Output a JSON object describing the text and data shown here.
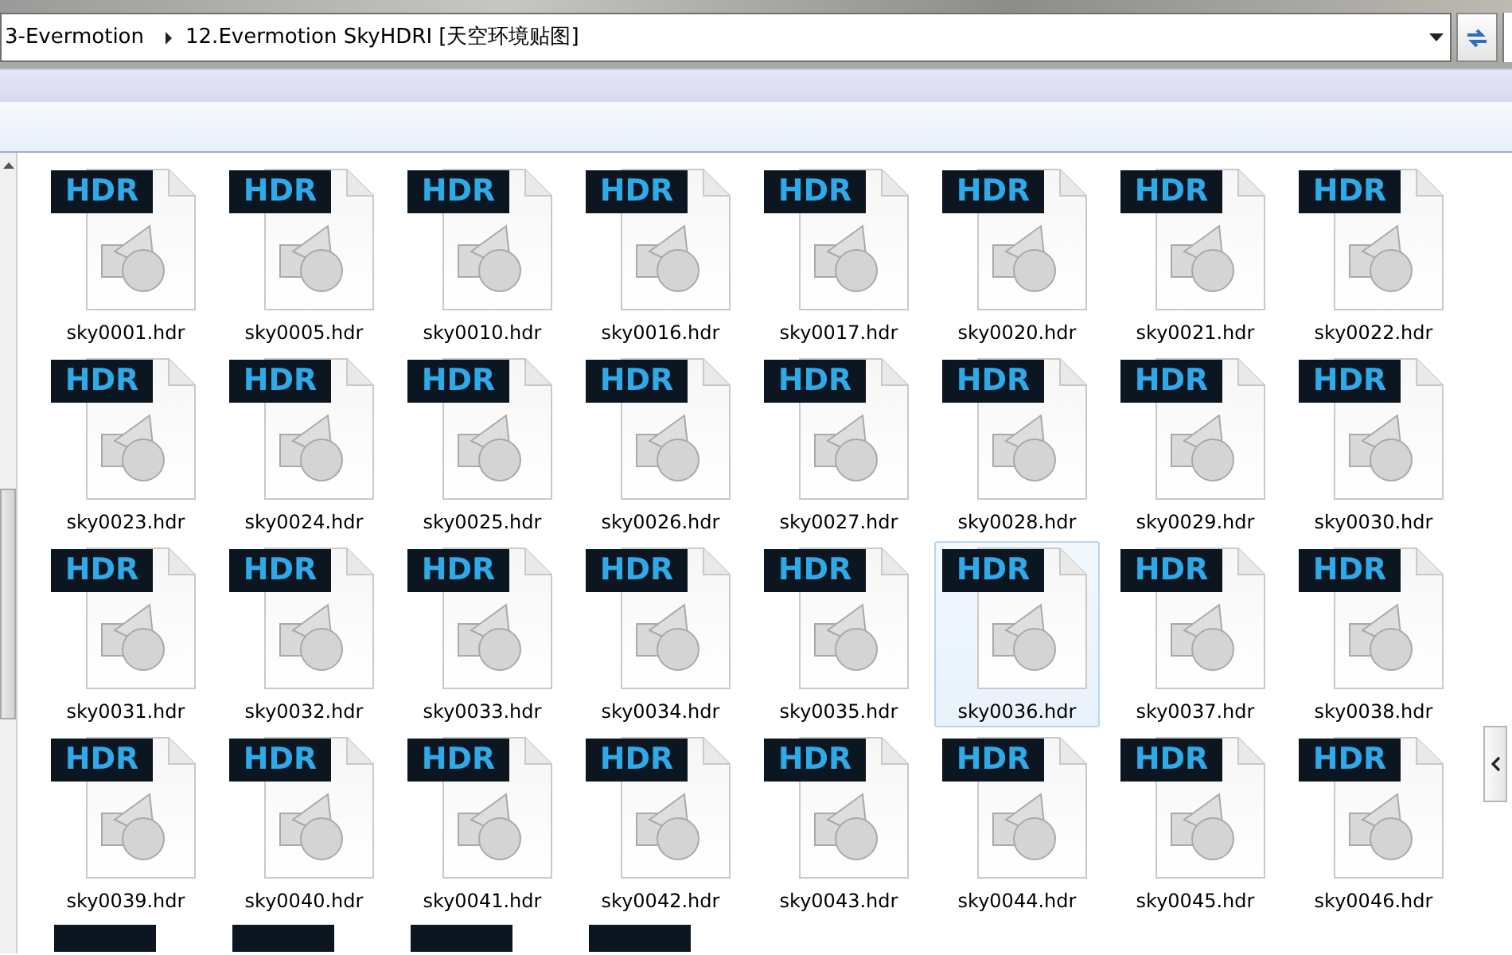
{
  "address_bar": {
    "breadcrumbs": [
      {
        "label": "3-Evermotion"
      },
      {
        "label": "12.Evermotion SkyHDRI [天空环境贴图]"
      }
    ]
  },
  "files": [
    {
      "name": "sky0001.hdr",
      "badge": "HDR",
      "selected": false
    },
    {
      "name": "sky0005.hdr",
      "badge": "HDR",
      "selected": false
    },
    {
      "name": "sky0010.hdr",
      "badge": "HDR",
      "selected": false
    },
    {
      "name": "sky0016.hdr",
      "badge": "HDR",
      "selected": false
    },
    {
      "name": "sky0017.hdr",
      "badge": "HDR",
      "selected": false
    },
    {
      "name": "sky0020.hdr",
      "badge": "HDR",
      "selected": false
    },
    {
      "name": "sky0021.hdr",
      "badge": "HDR",
      "selected": false
    },
    {
      "name": "sky0022.hdr",
      "badge": "HDR",
      "selected": false
    },
    {
      "name": "sky0023.hdr",
      "badge": "HDR",
      "selected": false
    },
    {
      "name": "sky0024.hdr",
      "badge": "HDR",
      "selected": false
    },
    {
      "name": "sky0025.hdr",
      "badge": "HDR",
      "selected": false
    },
    {
      "name": "sky0026.hdr",
      "badge": "HDR",
      "selected": false
    },
    {
      "name": "sky0027.hdr",
      "badge": "HDR",
      "selected": false
    },
    {
      "name": "sky0028.hdr",
      "badge": "HDR",
      "selected": false
    },
    {
      "name": "sky0029.hdr",
      "badge": "HDR",
      "selected": false
    },
    {
      "name": "sky0030.hdr",
      "badge": "HDR",
      "selected": false
    },
    {
      "name": "sky0031.hdr",
      "badge": "HDR",
      "selected": false
    },
    {
      "name": "sky0032.hdr",
      "badge": "HDR",
      "selected": false
    },
    {
      "name": "sky0033.hdr",
      "badge": "HDR",
      "selected": false
    },
    {
      "name": "sky0034.hdr",
      "badge": "HDR",
      "selected": false
    },
    {
      "name": "sky0035.hdr",
      "badge": "HDR",
      "selected": false
    },
    {
      "name": "sky0036.hdr",
      "badge": "HDR",
      "selected": true
    },
    {
      "name": "sky0037.hdr",
      "badge": "HDR",
      "selected": false
    },
    {
      "name": "sky0038.hdr",
      "badge": "HDR",
      "selected": false
    },
    {
      "name": "sky0039.hdr",
      "badge": "HDR",
      "selected": false
    },
    {
      "name": "sky0040.hdr",
      "badge": "HDR",
      "selected": false
    },
    {
      "name": "sky0041.hdr",
      "badge": "HDR",
      "selected": false
    },
    {
      "name": "sky0042.hdr",
      "badge": "HDR",
      "selected": false
    },
    {
      "name": "sky0043.hdr",
      "badge": "HDR",
      "selected": false
    },
    {
      "name": "sky0044.hdr",
      "badge": "HDR",
      "selected": false
    },
    {
      "name": "sky0045.hdr",
      "badge": "HDR",
      "selected": false
    },
    {
      "name": "sky0046.hdr",
      "badge": "HDR",
      "selected": false
    }
  ],
  "cut_off_icons": [
    {
      "kind": "hdr-file"
    },
    {
      "kind": "hdr-file"
    },
    {
      "kind": "hdr-file"
    },
    {
      "kind": "hdr-file"
    }
  ]
}
